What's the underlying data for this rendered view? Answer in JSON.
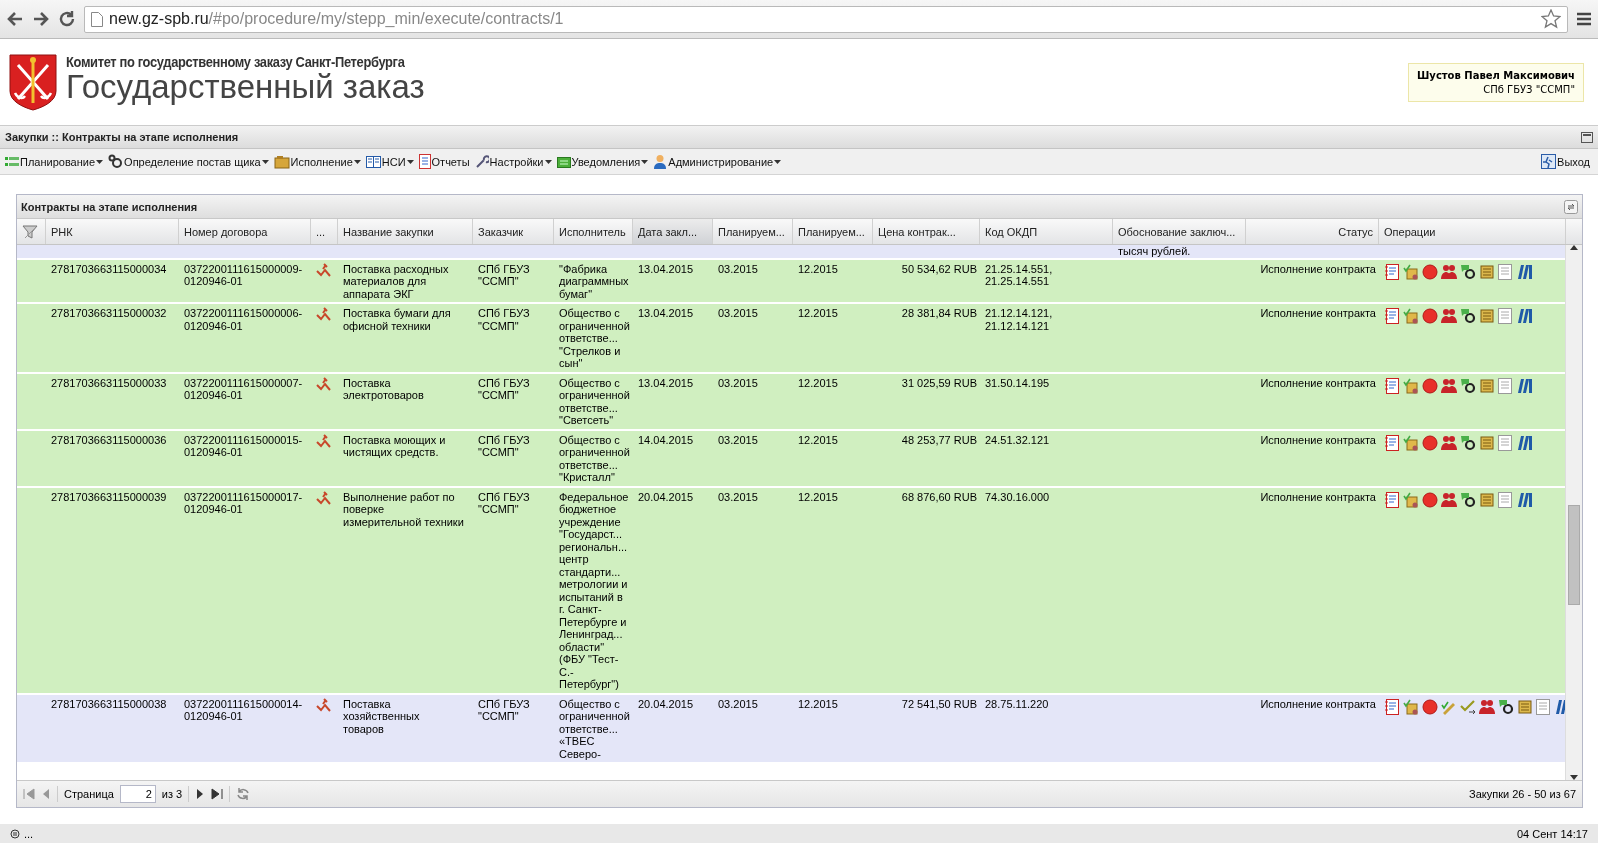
{
  "browser": {
    "url_host": "new.gz-spb.ru",
    "url_path": "/#po/procedure/my/stepp_min/execute/contracts/1"
  },
  "header": {
    "committee": "Комитет по государственному заказу Санкт-Петербурга",
    "title": "Государственный заказ",
    "user": {
      "name": "Шустов Павел Максимович",
      "organization": "СПб ГБУЗ \"ССМП\""
    }
  },
  "section_title": "Закупки :: Контракты на этапе исполнения",
  "menu": [
    {
      "label": "Планирование",
      "has_menu": true
    },
    {
      "label": "Определение постав щика",
      "has_menu": true
    },
    {
      "label": "Исполнение",
      "has_menu": true
    },
    {
      "label": "НСИ",
      "has_menu": true
    },
    {
      "label": "Отчеты",
      "has_menu": false
    },
    {
      "label": "Настройки",
      "has_menu": true
    },
    {
      "label": "Уведомления",
      "has_menu": true
    },
    {
      "label": "Администрирование",
      "has_menu": true
    }
  ],
  "logout": "Выход",
  "grid": {
    "title": "Контракты на этапе исполнения",
    "columns": [
      {
        "label": "РНК",
        "sorted": false
      },
      {
        "label": "Номер договора",
        "sorted": false
      },
      {
        "label": "...",
        "sorted": false
      },
      {
        "label": "Название закупки",
        "sorted": false
      },
      {
        "label": "Заказчик",
        "sorted": false
      },
      {
        "label": "Исполнитель",
        "sorted": false
      },
      {
        "label": "Дата закл...",
        "sorted": true
      },
      {
        "label": "Планируем...",
        "sorted": false
      },
      {
        "label": "Планируем...",
        "sorted": false
      },
      {
        "label": "Цена контрак...",
        "sorted": false
      },
      {
        "label": "Код ОКДП",
        "sorted": false
      },
      {
        "label": "Обоснование заключ...",
        "sorted": false
      },
      {
        "label": "Статус",
        "sorted": false
      },
      {
        "label": "Операции",
        "sorted": false
      }
    ],
    "partial_row": {
      "color": "#e4e6f8",
      "justification": "тысяч рублей."
    },
    "rows": [
      {
        "color": "#d0efc0",
        "rnk": "2781703663115000034",
        "contract_no": "0372200111615000009-\n0120946-01",
        "name": "Поставка расходных\nматериалов для\nаппарата ЭКГ",
        "customer": "СПб ГБУЗ\n\"ССМП\"",
        "executor": "\"Фабрика\nдиаграммных\nбумаг\"",
        "date": "13.04.2015",
        "plan_start": "03.2015",
        "plan_end": "12.2015",
        "price": "50 534,62 RUB",
        "okdp": "21.25.14.551,\n21.25.14.551",
        "status": "Исполнение контракта",
        "operations": [
          {
            "kind": "journal"
          },
          {
            "kind": "approve"
          },
          {
            "kind": "stop"
          },
          {
            "kind": "people"
          },
          {
            "kind": "settings"
          },
          {
            "kind": "scroll"
          },
          {
            "kind": "document"
          },
          {
            "kind": "binders"
          }
        ]
      },
      {
        "color": "#d0efc0",
        "rnk": "2781703663115000032",
        "contract_no": "0372200111615000006-\n0120946-01",
        "name": "Поставка бумаги для\nофисной техники",
        "customer": "СПб ГБУЗ\n\"ССМП\"",
        "executor": "Общество с\nограниченной\nответстве...\n\"Стрелков и\nсын\"",
        "date": "13.04.2015",
        "plan_start": "03.2015",
        "plan_end": "12.2015",
        "price": "28 381,84 RUB",
        "okdp": "21.12.14.121,\n21.12.14.121",
        "status": "Исполнение контракта",
        "operations": [
          {
            "kind": "journal"
          },
          {
            "kind": "approve"
          },
          {
            "kind": "stop"
          },
          {
            "kind": "people"
          },
          {
            "kind": "settings"
          },
          {
            "kind": "scroll"
          },
          {
            "kind": "document"
          },
          {
            "kind": "binders"
          }
        ]
      },
      {
        "color": "#d0efc0",
        "rnk": "2781703663115000033",
        "contract_no": "0372200111615000007-\n0120946-01",
        "name": "Поставка\nэлектротоваров",
        "customer": "СПб ГБУЗ\n\"ССМП\"",
        "executor": "Общество с\nограниченной\nответстве...\n\"Светсеть\"",
        "date": "13.04.2015",
        "plan_start": "03.2015",
        "plan_end": "12.2015",
        "price": "31 025,59 RUB",
        "okdp": "31.50.14.195",
        "status": "Исполнение контракта",
        "operations": [
          {
            "kind": "journal"
          },
          {
            "kind": "approve"
          },
          {
            "kind": "stop"
          },
          {
            "kind": "people"
          },
          {
            "kind": "settings"
          },
          {
            "kind": "scroll"
          },
          {
            "kind": "document"
          },
          {
            "kind": "binders"
          }
        ]
      },
      {
        "color": "#d0efc0",
        "rnk": "2781703663115000036",
        "contract_no": "0372200111615000015-\n0120946-01",
        "name": "Поставка моющих и\nчистящих средств.",
        "customer": "СПб ГБУЗ\n\"ССМП\"",
        "executor": "Общество с\nограниченной\nответстве...\n\"Кристалл\"",
        "date": "14.04.2015",
        "plan_start": "03.2015",
        "plan_end": "12.2015",
        "price": "48 253,77 RUB",
        "okdp": "24.51.32.121",
        "status": "Исполнение контракта",
        "operations": [
          {
            "kind": "journal"
          },
          {
            "kind": "approve"
          },
          {
            "kind": "stop"
          },
          {
            "kind": "people"
          },
          {
            "kind": "settings"
          },
          {
            "kind": "scroll"
          },
          {
            "kind": "document"
          },
          {
            "kind": "binders"
          }
        ]
      },
      {
        "color": "#d0efc0",
        "rnk": "2781703663115000039",
        "contract_no": "0372200111615000017-\n0120946-01",
        "name": "Выполнение работ по\nповерке\nизмерительной техники",
        "customer": "СПб ГБУЗ\n\"ССМП\"",
        "executor": "Федеральное\nбюджетное\nучреждение\n\"Государст...\nрегиональн...\nцентр\nстандарти...\nметрологии и\nиспытаний в\nг. Санкт-\nПетербурге и\nЛенинград...\nобласти\"\n(ФБУ \"Тест-\nС.-\nПетербург\")",
        "date": "20.04.2015",
        "plan_start": "03.2015",
        "plan_end": "12.2015",
        "price": "68 876,60 RUB",
        "okdp": "74.30.16.000",
        "status": "Исполнение контракта",
        "operations": [
          {
            "kind": "journal"
          },
          {
            "kind": "approve"
          },
          {
            "kind": "stop"
          },
          {
            "kind": "people"
          },
          {
            "kind": "settings"
          },
          {
            "kind": "scroll"
          },
          {
            "kind": "document"
          },
          {
            "kind": "binders"
          }
        ]
      },
      {
        "color": "#e4e6f8",
        "rnk": "2781703663115000038",
        "contract_no": "0372200111615000014-\n0120946-01",
        "name": "Поставка\nхозяйственных\nтоваров",
        "customer": "СПб ГБУЗ\n\"ССМП\"",
        "executor": "Общество с\nограниченной\nответстве...\n«ТВЕС\nСеверо-",
        "date": "20.04.2015",
        "plan_start": "03.2015",
        "plan_end": "12.2015",
        "price": "72 541,50 RUB",
        "okdp": "28.75.11.220",
        "status": "Исполнение контракта",
        "operations": [
          {
            "kind": "journal"
          },
          {
            "kind": "approve"
          },
          {
            "kind": "stop"
          },
          {
            "kind": "edit-check"
          },
          {
            "kind": "check-arrow"
          },
          {
            "kind": "people"
          },
          {
            "kind": "settings"
          },
          {
            "kind": "scroll"
          },
          {
            "kind": "document"
          },
          {
            "kind": "binders"
          }
        ]
      }
    ]
  },
  "paging": {
    "first_disabled": true,
    "prev_disabled": true,
    "next_disabled": false,
    "last_disabled": false,
    "page_label": "Страница",
    "page": "2",
    "of_label": "из 3",
    "summary": "Закупки 26 - 50 из 67"
  },
  "status_bar": {
    "left": "...",
    "right": "04 Сент 14:17"
  }
}
